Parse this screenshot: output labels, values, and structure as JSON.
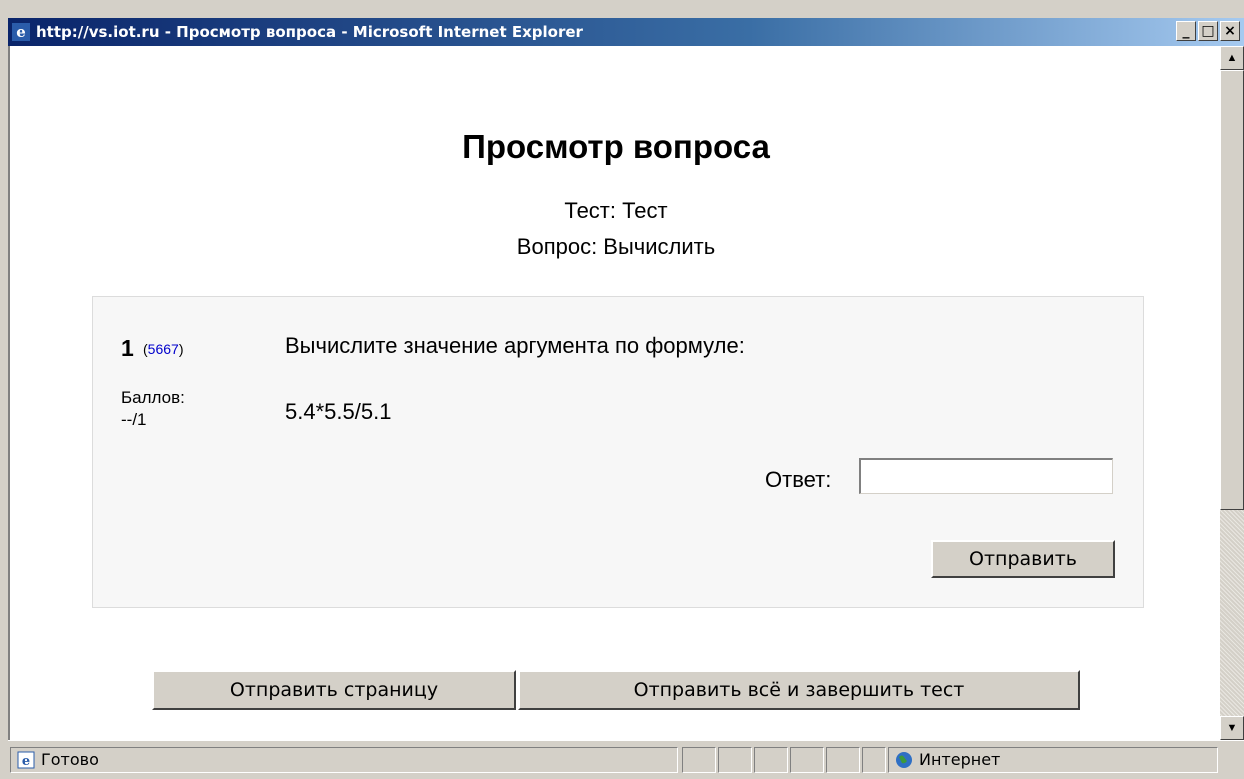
{
  "window": {
    "title": "http://vs.iot.ru - Просмотр вопроса - Microsoft Internet Explorer",
    "minimize_label": "_",
    "maximize_label": "□",
    "close_label": "×"
  },
  "page": {
    "title": "Просмотр вопроса",
    "test_line": "Тест: Тест",
    "question_line": "Вопрос: Вычислить"
  },
  "question": {
    "number": "1",
    "id_open": "(",
    "id_link": "5667",
    "id_close": ")",
    "grade_label": "Баллов:",
    "grade_value": "--/1",
    "text": "Вычислите значение аргумента по формуле:",
    "formula": "5.4*5.5/5.1",
    "answer_label": "Ответ:",
    "answer_value": "",
    "submit_label": "Отправить"
  },
  "footer": {
    "submit_page_label": "Отправить страницу",
    "submit_all_label": "Отправить всё и завершить тест"
  },
  "statusbar": {
    "status": "Готово",
    "zone": "Интернет"
  },
  "icons": {
    "browser": "ie-icon",
    "page_status": "page-icon",
    "zone": "globe-icon"
  }
}
